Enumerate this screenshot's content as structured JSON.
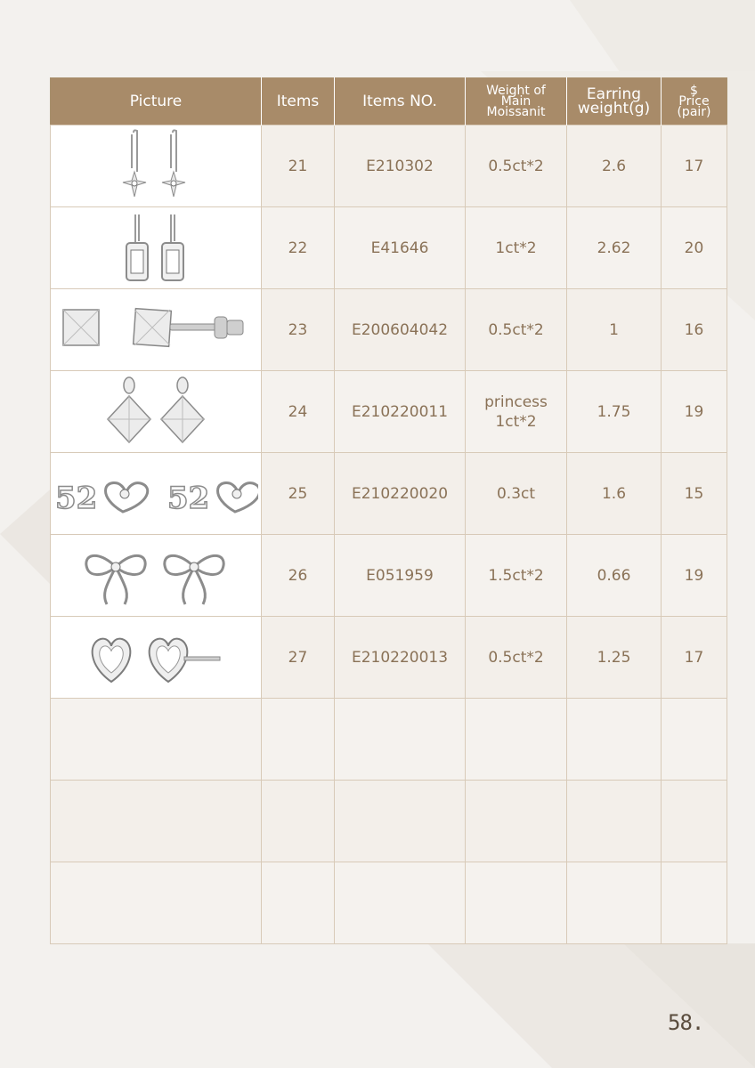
{
  "table": {
    "headers": {
      "picture": "Picture",
      "items": "Items",
      "items_no": "Items NO.",
      "weight_main": [
        "Weight of",
        "Main",
        "Moissanit"
      ],
      "earring_weight": [
        "Earring",
        "weight(g)"
      ],
      "price": [
        "$",
        "Price",
        "(pair)"
      ]
    },
    "rows": [
      {
        "picture": "flower-drop-earrings",
        "item": "21",
        "item_no": "E210302",
        "weight_main": [
          "0.5ct*2"
        ],
        "earring_weight": "2.6",
        "price": "17"
      },
      {
        "picture": "emerald-cut-halo-drop-earrings",
        "item": "22",
        "item_no": "E41646",
        "weight_main": [
          "1ct*2"
        ],
        "earring_weight": "2.62",
        "price": "20"
      },
      {
        "picture": "princess-cut-stud-earrings",
        "item": "23",
        "item_no": "E200604042",
        "weight_main": [
          "0.5ct*2"
        ],
        "earring_weight": "1",
        "price": "16"
      },
      {
        "picture": "princess-cut-drop-earrings",
        "item": "24",
        "item_no": "E210220011",
        "weight_main": [
          "princess",
          "1ct*2"
        ],
        "earring_weight": "1.75",
        "price": "19"
      },
      {
        "picture": "520-heart-stud-earrings",
        "item": "25",
        "item_no": "E210220020",
        "weight_main": [
          "0.3ct"
        ],
        "earring_weight": "1.6",
        "price": "15"
      },
      {
        "picture": "bow-stud-earrings",
        "item": "26",
        "item_no": "E051959",
        "weight_main": [
          "1.5ct*2"
        ],
        "earring_weight": "0.66",
        "price": "19"
      },
      {
        "picture": "heart-halo-stud-earrings",
        "item": "27",
        "item_no": "E210220013",
        "weight_main": [
          "0.5ct*2"
        ],
        "earring_weight": "1.25",
        "price": "17"
      }
    ]
  },
  "page_number": "58."
}
